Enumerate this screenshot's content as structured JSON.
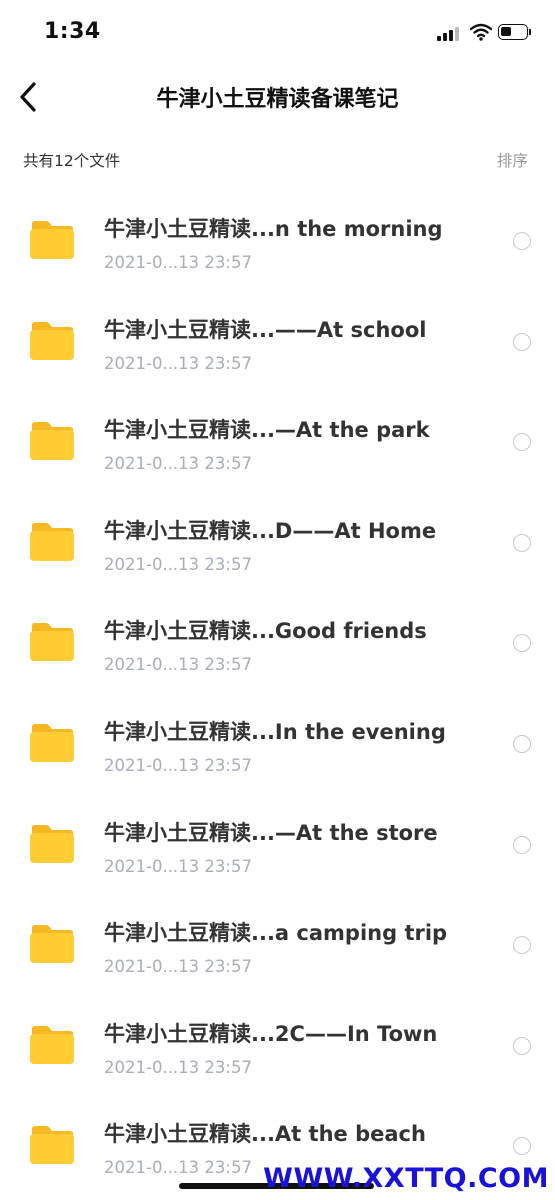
{
  "status_bar": {
    "time": "1:34",
    "battery_level": 0.45
  },
  "header": {
    "title": "牛津小土豆精读备课笔记"
  },
  "toolbar": {
    "count_text": "共有12个文件",
    "sort_label": "排序"
  },
  "files": [
    {
      "name": "牛津小土豆精读...n the morning",
      "date": "2021-0...13 23:57"
    },
    {
      "name": "牛津小土豆精读...——At school",
      "date": "2021-0...13 23:57"
    },
    {
      "name": "牛津小土豆精读...—At the park",
      "date": "2021-0...13 23:57"
    },
    {
      "name": "牛津小土豆精读...D——At Home",
      "date": "2021-0...13 23:57"
    },
    {
      "name": "牛津小土豆精读...Good friends",
      "date": "2021-0...13 23:57"
    },
    {
      "name": "牛津小土豆精读...In the evening",
      "date": "2021-0...13 23:57"
    },
    {
      "name": "牛津小土豆精读...—At the store",
      "date": "2021-0...13 23:57"
    },
    {
      "name": "牛津小土豆精读...a camping trip",
      "date": "2021-0...13 23:57"
    },
    {
      "name": "牛津小土豆精读...2C——In Town",
      "date": "2021-0...13 23:57"
    },
    {
      "name": "牛津小土豆精读...At  the beach",
      "date": "2021-0...13 23:57"
    }
  ],
  "watermark": "WWW.XXTTQ.COM",
  "colors": {
    "folder": "#ffcc33",
    "folder_tab": "#f5b820",
    "date_text": "#a9adb8",
    "watermark": "#1a12d9"
  },
  "icons": {
    "back": "chevron-left-icon",
    "folder": "folder-icon",
    "radio": "radio-unchecked-icon"
  }
}
